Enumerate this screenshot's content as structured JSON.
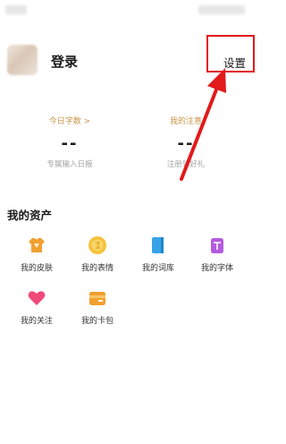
{
  "profile": {
    "login_label": "登录",
    "settings_label": "设置"
  },
  "stats": [
    {
      "title": "今日字数 >",
      "value": "--",
      "subtitle": "专属输入日报"
    },
    {
      "title": "我的注意",
      "value": "--",
      "subtitle": "注册领好礼"
    }
  ],
  "assets": {
    "title": "我的资产",
    "items": [
      {
        "label": "我的皮肤",
        "icon": "shirt-icon"
      },
      {
        "label": "我的表情",
        "icon": "emoji-coin-icon"
      },
      {
        "label": "我的词库",
        "icon": "book-icon"
      },
      {
        "label": "我的字体",
        "icon": "font-icon"
      },
      {
        "label": "我的关注",
        "icon": "heart-icon"
      },
      {
        "label": "我的卡包",
        "icon": "card-wallet-icon"
      }
    ]
  },
  "colors": {
    "annotation_red": "#e11a1a",
    "accent_gold": "#c99448"
  }
}
